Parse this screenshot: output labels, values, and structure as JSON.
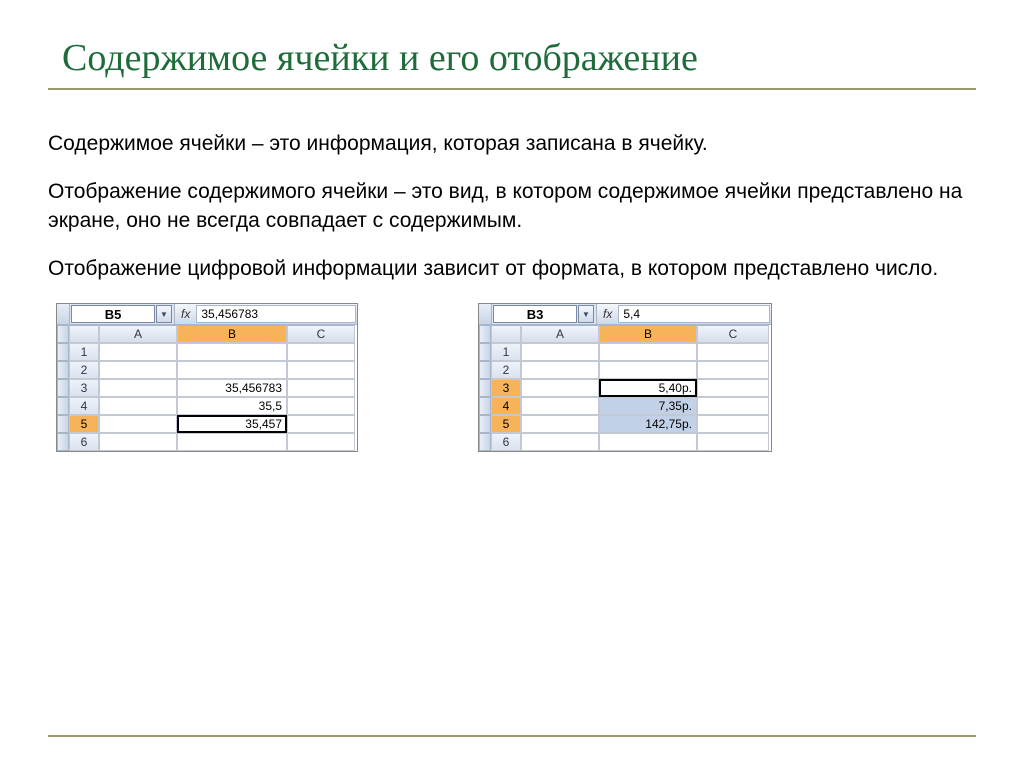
{
  "title": "Содержимое ячейки и его отображение",
  "paragraphs": {
    "p1": "Содержимое ячейки – это информация, которая записана в ячейку.",
    "p2": "Отображение содержимого ячейки – это вид, в котором содержимое ячейки представлено на экране, оно не всегда совпадает с содержимым.",
    "p3": "Отображение цифровой информации зависит от формата, в котором представлено число."
  },
  "shot1": {
    "namebox": "B5",
    "fx": "35,456783",
    "cols": [
      "",
      "A",
      "B",
      "C"
    ],
    "rows": [
      {
        "n": "1",
        "sel": false,
        "a": "",
        "b": "",
        "c": ""
      },
      {
        "n": "2",
        "sel": false,
        "a": "",
        "b": "",
        "c": ""
      },
      {
        "n": "3",
        "sel": false,
        "a": "",
        "b": "35,456783",
        "c": ""
      },
      {
        "n": "4",
        "sel": false,
        "a": "",
        "b": "35,5",
        "c": ""
      },
      {
        "n": "5",
        "sel": true,
        "a": "",
        "b": "35,457",
        "c": ""
      },
      {
        "n": "6",
        "sel": false,
        "a": "",
        "b": "",
        "c": ""
      }
    ],
    "sel_col": "B"
  },
  "shot2": {
    "namebox": "B3",
    "fx": "5,4",
    "cols": [
      "",
      "A",
      "B",
      "C"
    ],
    "rows": [
      {
        "n": "1",
        "sel": false,
        "a": "",
        "b": "",
        "c": ""
      },
      {
        "n": "2",
        "sel": false,
        "a": "",
        "b": "",
        "c": ""
      },
      {
        "n": "3",
        "sel": true,
        "a": "",
        "b": "5,40р.",
        "c": ""
      },
      {
        "n": "4",
        "sel": true,
        "a": "",
        "b": "7,35р.",
        "c": ""
      },
      {
        "n": "5",
        "sel": true,
        "a": "",
        "b": "142,75р.",
        "c": ""
      },
      {
        "n": "6",
        "sel": false,
        "a": "",
        "b": "",
        "c": ""
      }
    ],
    "sel_col": "B"
  }
}
